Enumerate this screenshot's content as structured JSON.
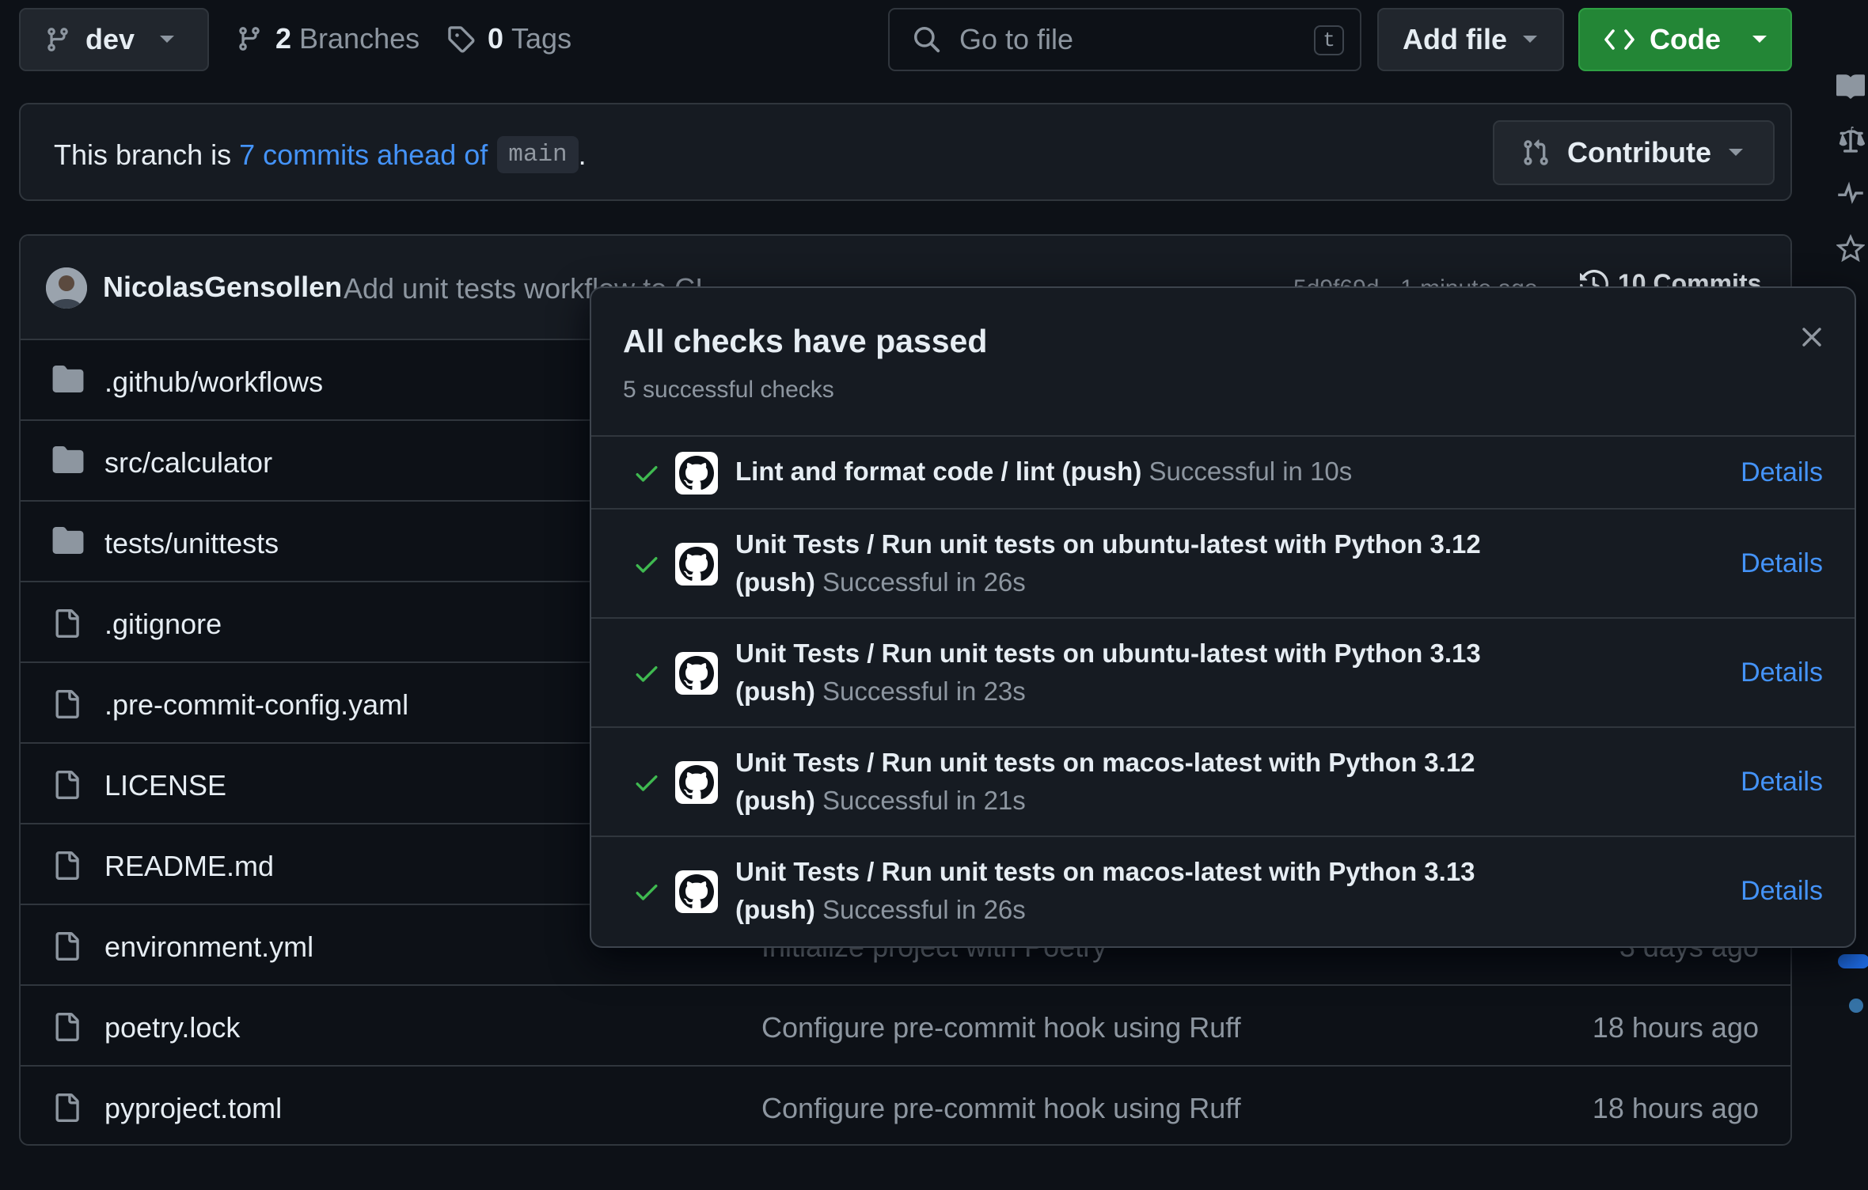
{
  "topbar": {
    "branch": "dev",
    "branches_count": "2",
    "branches_label": "Branches",
    "tags_count": "0",
    "tags_label": "Tags",
    "search_placeholder": "Go to file",
    "search_shortcut": "t",
    "add_file_label": "Add file",
    "code_label": "Code"
  },
  "banner": {
    "prefix": "This branch is ",
    "ahead_link": "7 commits ahead of",
    "base_branch": "main",
    "suffix": ".",
    "contribute_label": "Contribute"
  },
  "latest_commit": {
    "author": "NicolasGensollen",
    "message": "Add unit tests workflow to CI",
    "hash_time": "5d9f69d · 1 minute ago",
    "commits_label": "10 Commits"
  },
  "files": [
    {
      "name": ".github/workflows",
      "type": "folder",
      "message": "",
      "time": ""
    },
    {
      "name": "src/calculator",
      "type": "folder",
      "message": "",
      "time": ""
    },
    {
      "name": "tests/unittests",
      "type": "folder",
      "message": "",
      "time": ""
    },
    {
      "name": ".gitignore",
      "type": "file",
      "message": "",
      "time": ""
    },
    {
      "name": ".pre-commit-config.yaml",
      "type": "file",
      "message": "",
      "time": ""
    },
    {
      "name": "LICENSE",
      "type": "file",
      "message": "",
      "time": ""
    },
    {
      "name": "README.md",
      "type": "file",
      "message": "",
      "time": ""
    },
    {
      "name": "environment.yml",
      "type": "file",
      "message": "Initialize project with Poetry",
      "time": "3 days ago"
    },
    {
      "name": "poetry.lock",
      "type": "file",
      "message": "Configure pre-commit hook using Ruff",
      "time": "18 hours ago"
    },
    {
      "name": "pyproject.toml",
      "type": "file",
      "message": "Configure pre-commit hook using Ruff",
      "time": "18 hours ago"
    }
  ],
  "checks_popover": {
    "title": "All checks have passed",
    "subtitle": "5 successful checks",
    "details_label": "Details",
    "checks": [
      {
        "name": "Lint and format code / lint (push)",
        "status": "Successful in 10s"
      },
      {
        "name": "Unit Tests / Run unit tests on ubuntu-latest with Python 3.12 (push)",
        "status": "Successful in 26s"
      },
      {
        "name": "Unit Tests / Run unit tests on ubuntu-latest with Python 3.13 (push)",
        "status": "Successful in 23s"
      },
      {
        "name": "Unit Tests / Run unit tests on macos-latest with Python 3.12 (push)",
        "status": "Successful in 21s"
      },
      {
        "name": "Unit Tests / Run unit tests on macos-latest with Python 3.13 (push)",
        "status": "Successful in 26s"
      }
    ]
  },
  "colors": {
    "background": "#0d1117",
    "accent_link": "#4493f8",
    "success": "#3fb950",
    "code_button": "#238636"
  }
}
